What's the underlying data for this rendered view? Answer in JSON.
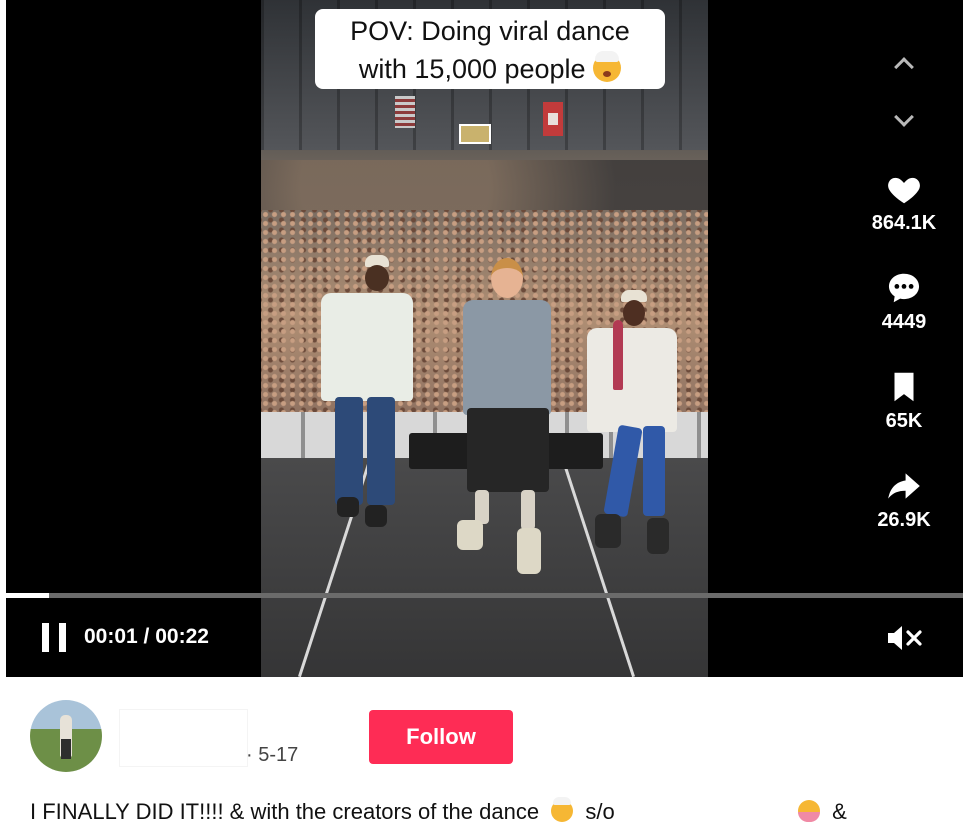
{
  "video": {
    "caption_line1": "POV: Doing viral dance",
    "caption_line2": "with 15,000 people",
    "caption_emoji": "exploding-head-emoji",
    "progress_fraction": 0.045,
    "time_display": "00:01 / 00:22",
    "muted": true
  },
  "actions": {
    "likes": "864.1K",
    "comments": "4449",
    "saves": "65K",
    "shares": "26.9K"
  },
  "author": {
    "date": "5-17",
    "follow_label": "Follow"
  },
  "description": {
    "part1": "I FINALLY DID IT!!!! & with the creators of the dance",
    "part2": "s/o",
    "part3": "&"
  },
  "colors": {
    "accent": "#fe2c55",
    "player_bg": "#000000",
    "icon": "#ffffff"
  }
}
